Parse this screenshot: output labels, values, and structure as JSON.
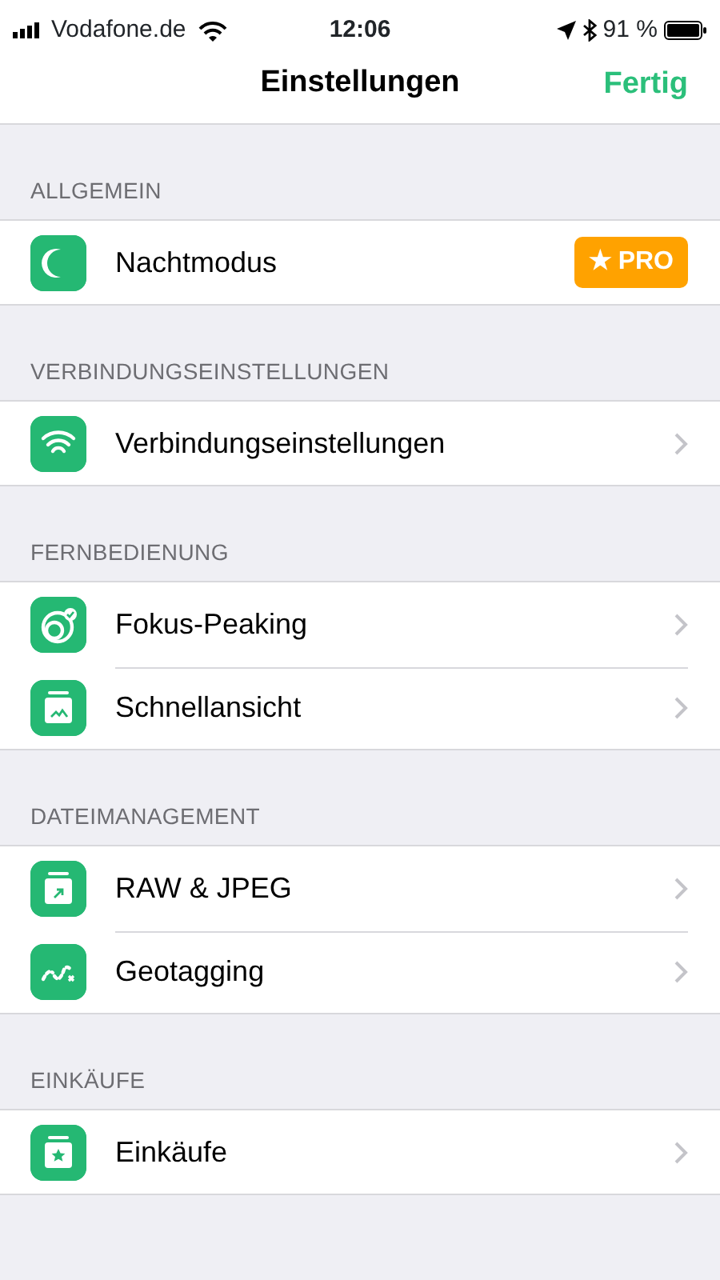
{
  "status_bar": {
    "carrier": "Vodafone.de",
    "time": "12:06",
    "battery": "91 %"
  },
  "nav_bar": {
    "title": "Einstellungen",
    "done": "Fertig"
  },
  "sections": [
    {
      "header": "ALLGEMEIN",
      "items": [
        {
          "kind": "badge",
          "label": "Nachtmodus",
          "badge": "★ PRO"
        }
      ]
    },
    {
      "header": "VERBINDUNGSEINSTELLUNGEN",
      "items": [
        {
          "kind": "chevron",
          "label": "Verbindungseinstellungen"
        }
      ]
    },
    {
      "header": "FERNBEDIENUNG",
      "items": [
        {
          "kind": "chevron",
          "label": "Fokus-Peaking"
        },
        {
          "kind": "chevron",
          "label": "Schnellansicht"
        }
      ]
    },
    {
      "header": "DATEIMANAGEMENT",
      "items": [
        {
          "kind": "chevron",
          "label": "RAW & JPEG"
        },
        {
          "kind": "chevron",
          "label": "Geotagging"
        }
      ]
    },
    {
      "header": "EINKÄUFE",
      "items": [
        {
          "kind": "chevron",
          "label": "Einkäufe"
        }
      ]
    }
  ]
}
